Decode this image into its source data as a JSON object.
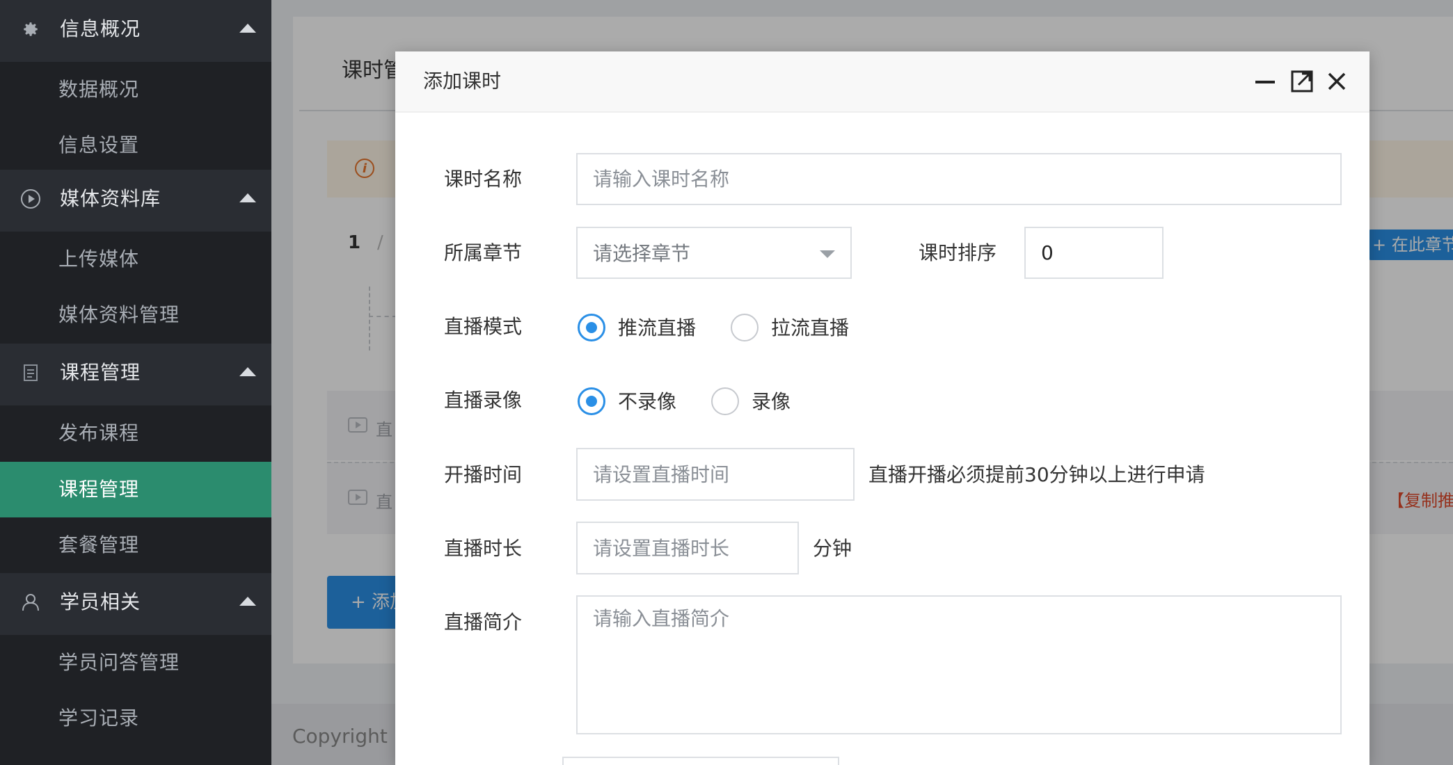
{
  "sidebar": {
    "groups": [
      {
        "label": "信息概况",
        "icon": "gear-icon",
        "items": [
          "数据概况",
          "信息设置"
        ]
      },
      {
        "label": "媒体资料库",
        "icon": "play-circle-icon",
        "items": [
          "上传媒体",
          "媒体资料管理"
        ]
      },
      {
        "label": "课程管理",
        "icon": "document-icon",
        "items": [
          "发布课程",
          "课程管理",
          "套餐管理"
        ]
      },
      {
        "label": "学员相关",
        "icon": "user-icon",
        "items": [
          "学员问答管理",
          "学习记录"
        ]
      }
    ],
    "active_item": "课程管理"
  },
  "background_page": {
    "card_title_partial": "课时管",
    "breadcrumb_index": "1",
    "breadcrumb_sep": "/",
    "row1_text_partial": "直",
    "row2_text_partial": "直",
    "add_button_partial": "+ 添加",
    "chapter_button_partial": "+ 在此章节",
    "copy_link_partial": "【复制推",
    "copyright_partial": "Copyright ©"
  },
  "modal": {
    "title": "添加课时",
    "form": {
      "lesson_name": {
        "label": "课时名称",
        "placeholder": "请输入课时名称"
      },
      "chapter": {
        "label": "所属章节",
        "placeholder": "请选择章节"
      },
      "order": {
        "label": "课时排序",
        "value": "0"
      },
      "live_mode": {
        "label": "直播模式",
        "options": [
          "推流直播",
          "拉流直播"
        ],
        "selected": "推流直播"
      },
      "live_record": {
        "label": "直播录像",
        "options": [
          "不录像",
          "录像"
        ],
        "selected": "不录像"
      },
      "start_time": {
        "label": "开播时间",
        "placeholder": "请设置直播时间",
        "hint": "直播开播必须提前30分钟以上进行申请"
      },
      "duration": {
        "label": "直播时长",
        "placeholder": "请设置直播时长",
        "unit": "分钟"
      },
      "intro": {
        "label": "直播简介",
        "placeholder": "请输入直播简介"
      }
    }
  },
  "colors": {
    "sidebar_bg": "#1f2125",
    "sidebar_group_bg": "#2a2d33",
    "sidebar_active": "#2b8c6e",
    "accent_blue": "#2a8fe6",
    "warning_orange": "#e8742a",
    "link_red": "#e04a2c"
  }
}
